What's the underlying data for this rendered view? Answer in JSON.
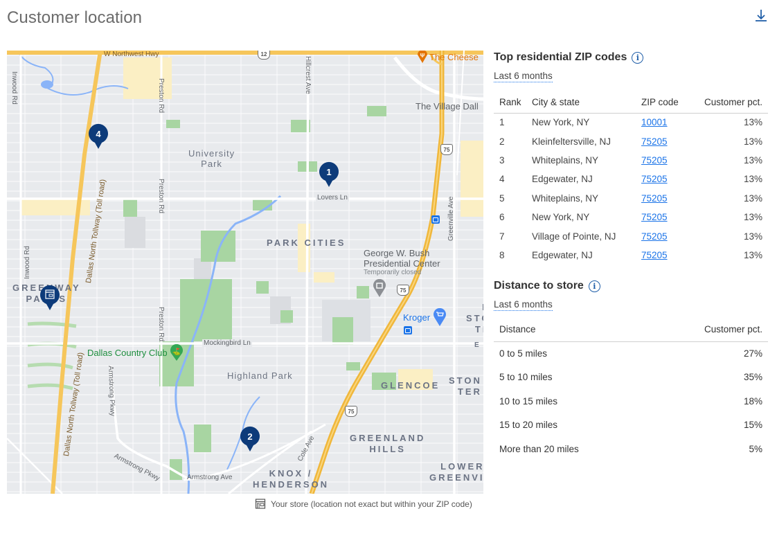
{
  "page": {
    "title": "Customer location",
    "download_icon": "download-icon"
  },
  "map": {
    "roads": {
      "northwest_hwy": "W Northwest Hwy",
      "route_12": "12",
      "hillcrest": "Hillcrest Ave",
      "preston_top": "Preston Rd",
      "preston_mid": "Preston Rd",
      "preston_low": "Preston Rd",
      "inwood_top": "Inwood Rd",
      "inwood_mid": "Inwood Rd",
      "tollway_top": "Dallas North Tollway (Toll road)",
      "tollway_bottom": "Dallas North Tollway (Toll road)",
      "lovers_ln": "Lovers Ln",
      "greenville": "Greenville Ave",
      "mockingbird": "Mockingbird Ln",
      "armstrong_pkwy_v": "Armstrong Pkwy",
      "armstrong_pkwy_d": "Armstrong Pkwy",
      "armstrong_ave": "Armstrong Ave",
      "cole_ave": "Cole Ave",
      "us75_a": "75",
      "us75_b": "75",
      "us75_c": "75"
    },
    "areas": {
      "university_park": "University\nPark",
      "park_cities": "PARK CITIES",
      "greenway_parks": "GREENWAY\nPARKS",
      "highland_park": "Highland Park",
      "glencoe": "GLENCOE",
      "greenland_hills": "GREENLAND\nHILLS",
      "knox_henderson": "KNOX /\nHENDERSON",
      "stonebridge_top": "N\nSTO\nTE",
      "stonebridge": "STON\nTER",
      "lower_greenville": "LOWER\nGREENVI",
      "east_edge": "E"
    },
    "pois": {
      "cheesecake": "The Cheese",
      "village": "The Village Dall",
      "bush_center": "George W. Bush\nPresidential Center",
      "bush_status": "Temporarily closed",
      "kroger": "Kroger",
      "country_club": "Dallas Country Club"
    },
    "pins": [
      {
        "label": "1",
        "type": "customer-cluster"
      },
      {
        "label": "2",
        "type": "customer-cluster"
      },
      {
        "label": "4",
        "type": "customer-cluster"
      },
      {
        "label": "",
        "type": "store"
      }
    ],
    "pin_color": "#0d3b7a",
    "caption": "Your store (location not exact but within your ZIP code)"
  },
  "zip_section": {
    "title": "Top residential ZIP codes",
    "period": "Last 6 months",
    "columns": [
      "Rank",
      "City & state",
      "ZIP code",
      "Customer pct."
    ],
    "rows": [
      {
        "rank": "1",
        "city": "New York, NY",
        "zip": "10001",
        "pct": "13%"
      },
      {
        "rank": "2",
        "city": "Kleinfeltersville, NJ",
        "zip": "75205",
        "pct": "13%"
      },
      {
        "rank": "3",
        "city": "Whiteplains, NY",
        "zip": "75205",
        "pct": "13%"
      },
      {
        "rank": "4",
        "city": "Edgewater, NJ",
        "zip": "75205",
        "pct": "13%"
      },
      {
        "rank": "5",
        "city": "Whiteplains, NY",
        "zip": "75205",
        "pct": "13%"
      },
      {
        "rank": "6",
        "city": "New York, NY",
        "zip": "75205",
        "pct": "13%"
      },
      {
        "rank": "7",
        "city": "Village of Pointe, NJ",
        "zip": "75205",
        "pct": "13%"
      },
      {
        "rank": "8",
        "city": "Edgewater, NJ",
        "zip": "75205",
        "pct": "13%"
      }
    ]
  },
  "distance_section": {
    "title": "Distance to store",
    "period": "Last 6 months",
    "columns": [
      "Distance",
      "Customer pct."
    ],
    "rows": [
      {
        "distance": "0 to 5 miles",
        "pct": "27%"
      },
      {
        "distance": "5 to 10 miles",
        "pct": "35%"
      },
      {
        "distance": "10 to 15 miles",
        "pct": "18%"
      },
      {
        "distance": "15 to 20 miles",
        "pct": "15%"
      },
      {
        "distance": "More than 20 miles",
        "pct": "5%"
      }
    ]
  },
  "colors": {
    "link": "#1a73e8",
    "accent": "#1f5ea8",
    "map_bg": "#e8eaed",
    "highway": "#f6c65b",
    "park": "#a8d5a2",
    "water": "#8ab4f8"
  }
}
